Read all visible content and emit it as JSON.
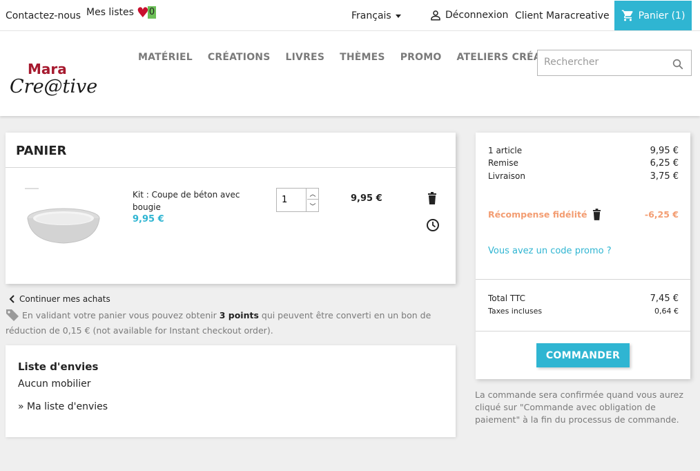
{
  "topbar": {
    "contact": "Contactez-nous",
    "lists_label": "Mes listes",
    "lists_count": "0",
    "language": "Français",
    "logout": "Déconnexion",
    "customer": "Client Maracreative",
    "cart_label": "Panier (1)"
  },
  "header": {
    "logo_line1": "Mara",
    "logo_line2": "Cre@tive",
    "nav": [
      "MATÉRIEL",
      "CRÉATIONS",
      "LIVRES",
      "THÈMES",
      "PROMO",
      "ATELIERS CRÉATIFS"
    ],
    "search_placeholder": "Rechercher"
  },
  "cart": {
    "title": "PANIER",
    "item": {
      "name": "Kit : Coupe de béton avec bougie",
      "price": "9,95 €",
      "quantity": "1",
      "line_total": "9,95 €"
    },
    "continue": "Continuer mes achats",
    "loyalty_before": "En validant votre panier vous pouvez obtenir ",
    "loyalty_points": "3 points",
    "loyalty_after": " qui peuvent être converti en un bon de réduction de 0,15 € (not available for Instant checkout order)."
  },
  "wishlist": {
    "title": "Liste d'envies",
    "empty": "Aucun mobilier",
    "link": "» Ma liste d'envies"
  },
  "summary": {
    "rows": [
      {
        "label": "1 article",
        "value": "9,95 €"
      },
      {
        "label": "Remise",
        "value": "6,25 €"
      },
      {
        "label": "Livraison",
        "value": "3,75 €"
      }
    ],
    "reward_label": "Récompense fidélité",
    "reward_value": "-6,25 €",
    "promo": "Vous avez un code promo ?",
    "total_label": "Total TTC",
    "total_value": "7,45 €",
    "tax_label": "Taxes incluses",
    "tax_value": "0,64 €",
    "order_button": "COMMANDER",
    "confirm_note": "La commande sera confirmée quand vous aurez cliqué sur \"Commande avec obligation de paiement\" à la fin du processus de commande."
  },
  "colors": {
    "accent": "#2fb5d2",
    "reward": "#f39d72",
    "logo_red": "#a6192e"
  }
}
